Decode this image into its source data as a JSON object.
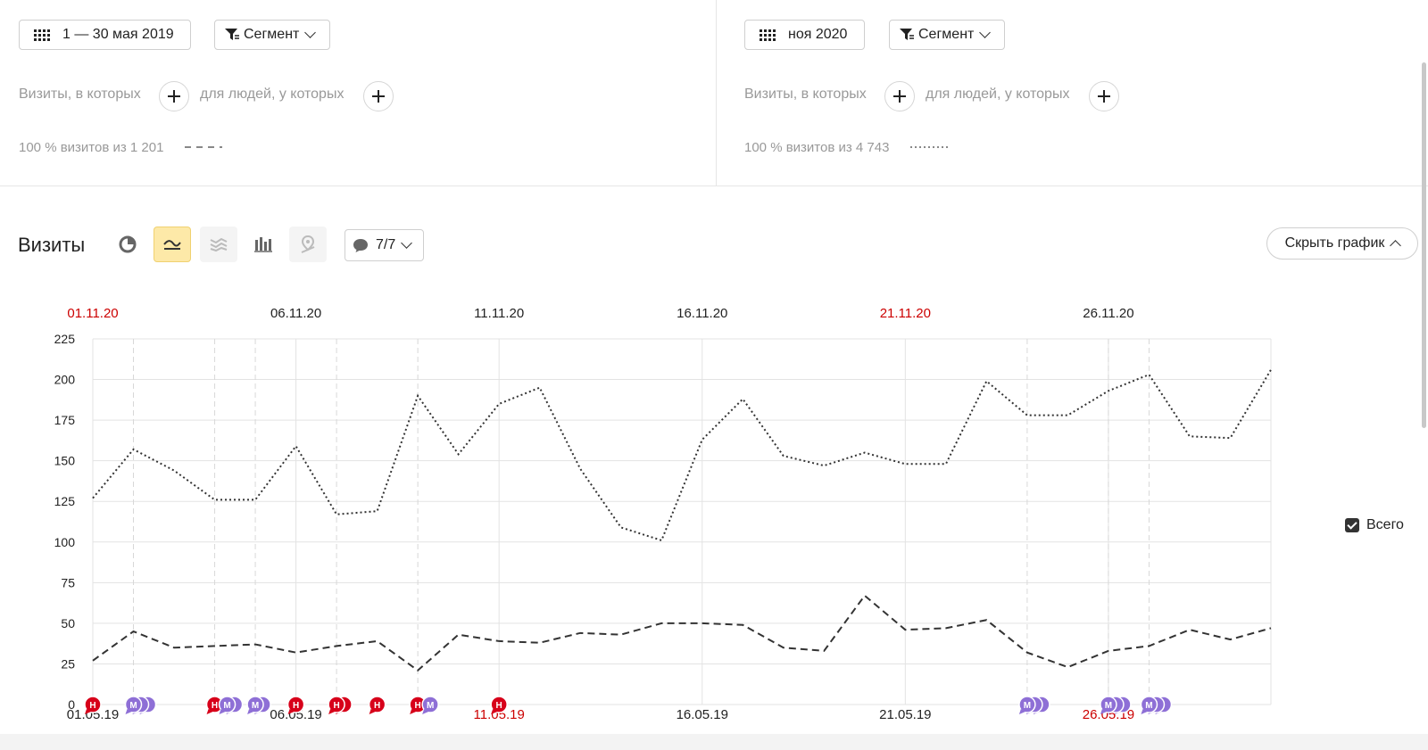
{
  "left_panel": {
    "date_label": "1 — 30 мая 2019",
    "segment_label": "Сегмент",
    "visits_where_label": "Визиты, в которых",
    "people_where_label": "для людей, у которых",
    "share_text": "100 % визитов из 1 201",
    "line_style": "dashed"
  },
  "right_panel": {
    "date_label": "ноя 2020",
    "segment_label": "Сегмент",
    "visits_where_label": "Визиты, в которых",
    "people_where_label": "для людей, у которых",
    "share_text": "100 % визитов из 4 743",
    "line_style": "dotted"
  },
  "report": {
    "title": "Визиты",
    "annotations_label": "7/7",
    "hide_chart_label": "Скрыть график",
    "legend_label": "Всего",
    "toolbar_icons": [
      "pie-chart-icon",
      "line-chart-icon",
      "area-chart-icon",
      "bar-chart-icon",
      "map-icon"
    ]
  },
  "chart_data": {
    "type": "line",
    "ylim": [
      0,
      225
    ],
    "y_ticks": [
      "0",
      "25",
      "50",
      "75",
      "100",
      "125",
      "150",
      "175",
      "200",
      "225"
    ],
    "top_x_labels": [
      {
        "text": "01.11.20",
        "index": 0,
        "color": "#cc0000"
      },
      {
        "text": "06.11.20",
        "index": 5,
        "color": "#222222"
      },
      {
        "text": "11.11.20",
        "index": 10,
        "color": "#222222"
      },
      {
        "text": "16.11.20",
        "index": 15,
        "color": "#222222"
      },
      {
        "text": "21.11.20",
        "index": 20,
        "color": "#cc0000"
      },
      {
        "text": "26.11.20",
        "index": 25,
        "color": "#222222"
      }
    ],
    "bottom_x_labels": [
      {
        "text": "01.05.19",
        "index": 0,
        "color": "#222222"
      },
      {
        "text": "06.05.19",
        "index": 5,
        "color": "#222222"
      },
      {
        "text": "11.05.19",
        "index": 10,
        "color": "#cc0000"
      },
      {
        "text": "16.05.19",
        "index": 15,
        "color": "#222222"
      },
      {
        "text": "21.05.19",
        "index": 20,
        "color": "#222222"
      },
      {
        "text": "26.05.19",
        "index": 25,
        "color": "#cc0000"
      }
    ],
    "series": [
      {
        "style": "dotted",
        "values": [
          127,
          157,
          144,
          126,
          126,
          159,
          117,
          119,
          190,
          154,
          185,
          195,
          145,
          109,
          101,
          163,
          188,
          153,
          147,
          155,
          148,
          148,
          199,
          178,
          178,
          193,
          203,
          165,
          164,
          206
        ]
      },
      {
        "style": "dashed",
        "values": [
          27,
          45,
          35,
          36,
          37,
          32,
          36,
          39,
          21,
          43,
          39,
          38,
          44,
          43,
          50,
          50,
          49,
          35,
          33,
          67,
          46,
          47,
          52,
          32,
          23,
          33,
          36,
          46,
          40,
          47
        ]
      }
    ],
    "event_markers": [
      {
        "index": 0,
        "kind": "red",
        "letter": "Н",
        "count": 1
      },
      {
        "index": 1,
        "kind": "purple",
        "letter": "М",
        "count": 3
      },
      {
        "index": 3,
        "kind": "red",
        "letter": "Н",
        "count": 1
      },
      {
        "index": 3,
        "kind": "purple",
        "letter": "М",
        "count": 2
      },
      {
        "index": 4,
        "kind": "purple",
        "letter": "М",
        "count": 2
      },
      {
        "index": 5,
        "kind": "red",
        "letter": "Н",
        "count": 1
      },
      {
        "index": 6,
        "kind": "red",
        "letter": "Н",
        "count": 2
      },
      {
        "index": 7,
        "kind": "red",
        "letter": "Н",
        "count": 1
      },
      {
        "index": 8,
        "kind": "red",
        "letter": "Н",
        "count": 1
      },
      {
        "index": 8,
        "kind": "purple",
        "letter": "М",
        "count": 1
      },
      {
        "index": 10,
        "kind": "red",
        "letter": "Н",
        "count": 1
      },
      {
        "index": 23,
        "kind": "purple",
        "letter": "М",
        "count": 3
      },
      {
        "index": 25,
        "kind": "purple",
        "letter": "М",
        "count": 3
      },
      {
        "index": 26,
        "kind": "purple",
        "letter": "М",
        "count": 3
      }
    ],
    "vertical_event_lines": [
      1,
      3,
      4,
      6,
      8,
      23,
      25,
      26
    ],
    "grid": true,
    "legend": "right"
  }
}
